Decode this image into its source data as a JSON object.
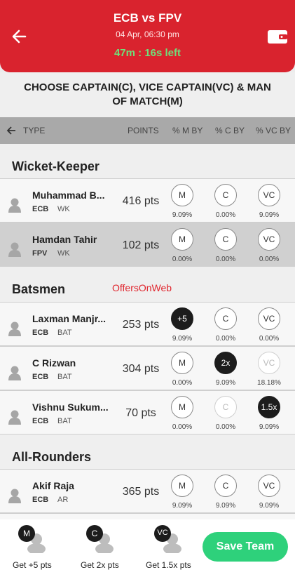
{
  "header": {
    "title": "ECB vs FPV",
    "date": "04 Apr, 06:30 pm",
    "timer": "47m : 16s left"
  },
  "prompt": "CHOOSE CAPTAIN(C), VICE CAPTAIN(VC) & MAN OF MATCH(M)",
  "columns": {
    "type": "TYPE",
    "points": "POINTS",
    "m_by": "% M BY",
    "c_by": "% C BY",
    "vc_by": "% VC BY"
  },
  "sections": {
    "wicket_keeper": "Wicket-Keeper",
    "batsmen": "Batsmen",
    "all_rounders": "All-Rounders"
  },
  "watermark": "OffersOnWeb",
  "players": [
    {
      "name": "Muhammad B...",
      "team": "ECB",
      "role": "WK",
      "pts": "416 pts",
      "m": "M",
      "c": "C",
      "vc": "VC",
      "m_pct": "9.09%",
      "c_pct": "0.00%",
      "vc_pct": "9.09%"
    },
    {
      "name": "Hamdan Tahir",
      "team": "FPV",
      "role": "WK",
      "pts": "102 pts",
      "m": "M",
      "c": "C",
      "vc": "VC",
      "m_pct": "0.00%",
      "c_pct": "0.00%",
      "vc_pct": "0.00%"
    },
    {
      "name": "Laxman Manjr...",
      "team": "ECB",
      "role": "BAT",
      "pts": "253 pts",
      "m": "+5",
      "c": "C",
      "vc": "VC",
      "m_pct": "9.09%",
      "c_pct": "0.00%",
      "vc_pct": "0.00%"
    },
    {
      "name": "C Rizwan",
      "team": "ECB",
      "role": "BAT",
      "pts": "304 pts",
      "m": "M",
      "c": "2x",
      "vc": "VC",
      "m_pct": "0.00%",
      "c_pct": "9.09%",
      "vc_pct": "18.18%"
    },
    {
      "name": "Vishnu Sukum...",
      "team": "ECB",
      "role": "BAT",
      "pts": "70 pts",
      "m": "M",
      "c": "C",
      "vc": "1.5x",
      "m_pct": "0.00%",
      "c_pct": "0.00%",
      "vc_pct": "9.09%"
    },
    {
      "name": "Akif Raja",
      "team": "ECB",
      "role": "AR",
      "pts": "365 pts",
      "m": "M",
      "c": "C",
      "vc": "VC",
      "m_pct": "9.09%",
      "c_pct": "9.09%",
      "vc_pct": "9.09%"
    }
  ],
  "footer": {
    "m_badge": "M",
    "m_label": "Get +5 pts",
    "c_badge": "C",
    "c_label": "Get 2x pts",
    "vc_badge": "VC",
    "vc_label": "Get 1.5x pts",
    "save": "Save Team"
  },
  "colors": {
    "header": "#d9232e",
    "timer": "#6ee07a",
    "save": "#2ed17b",
    "selected": "#1c1c1c"
  }
}
